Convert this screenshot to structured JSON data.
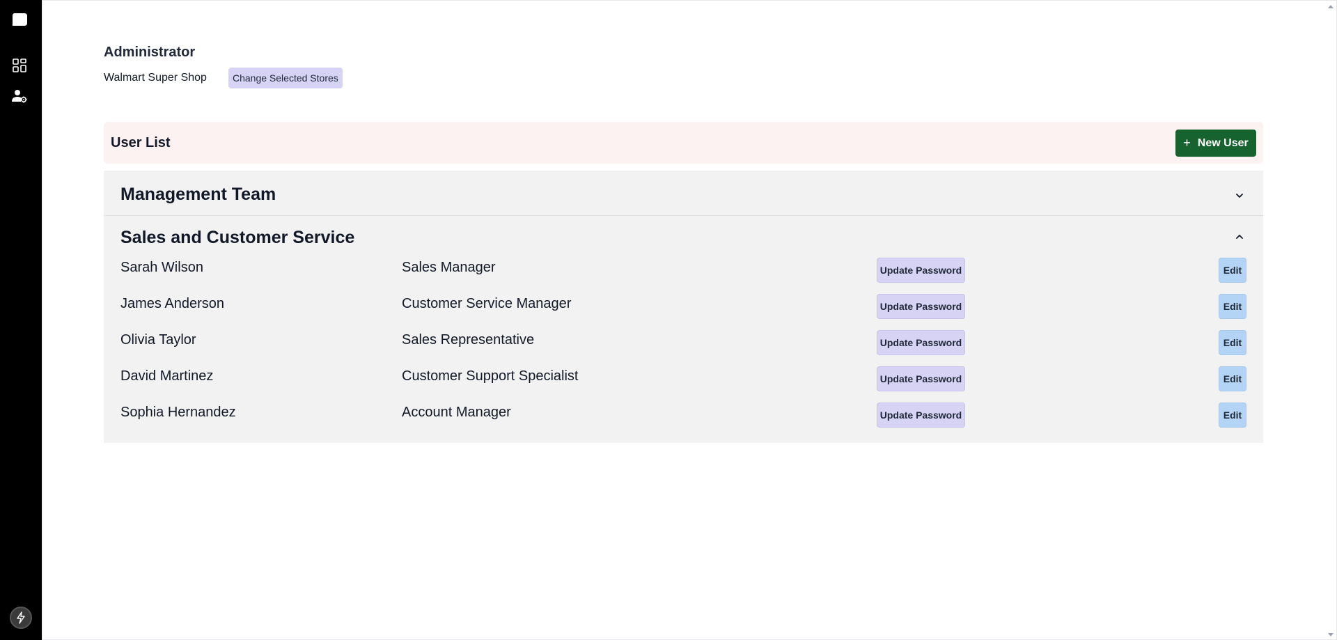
{
  "sidebar": {
    "icons": [
      "logo-icon",
      "dashboard-icon",
      "user-settings-icon",
      "avatar-icon"
    ]
  },
  "header": {
    "role_title": "Administrator",
    "store_name": "Walmart Super Shop",
    "change_stores_label": "Change Selected Stores"
  },
  "user_list": {
    "title": "User List",
    "new_user_label": "New User",
    "new_user_icon": "plus-icon"
  },
  "groups": [
    {
      "title": "Management Team",
      "expanded": false
    },
    {
      "title": "Sales and Customer Service",
      "expanded": true,
      "users": [
        {
          "name": "Sarah Wilson",
          "role": "Sales Manager"
        },
        {
          "name": "James Anderson",
          "role": "Customer Service Manager"
        },
        {
          "name": "Olivia Taylor",
          "role": "Sales Representative"
        },
        {
          "name": "David Martinez",
          "role": "Customer Support Specialist"
        },
        {
          "name": "Sophia Hernandez",
          "role": "Account Manager"
        }
      ]
    }
  ],
  "row_actions": {
    "update_password_label": "Update Password",
    "edit_label": "Edit"
  },
  "colors": {
    "sidebar_bg": "#000000",
    "new_user_btn": "#17632f",
    "user_list_bar": "#fdf2f2",
    "group_bg": "#f2f2f2",
    "update_password_btn": "#d6d3f5",
    "edit_btn": "#b3d4f5"
  }
}
